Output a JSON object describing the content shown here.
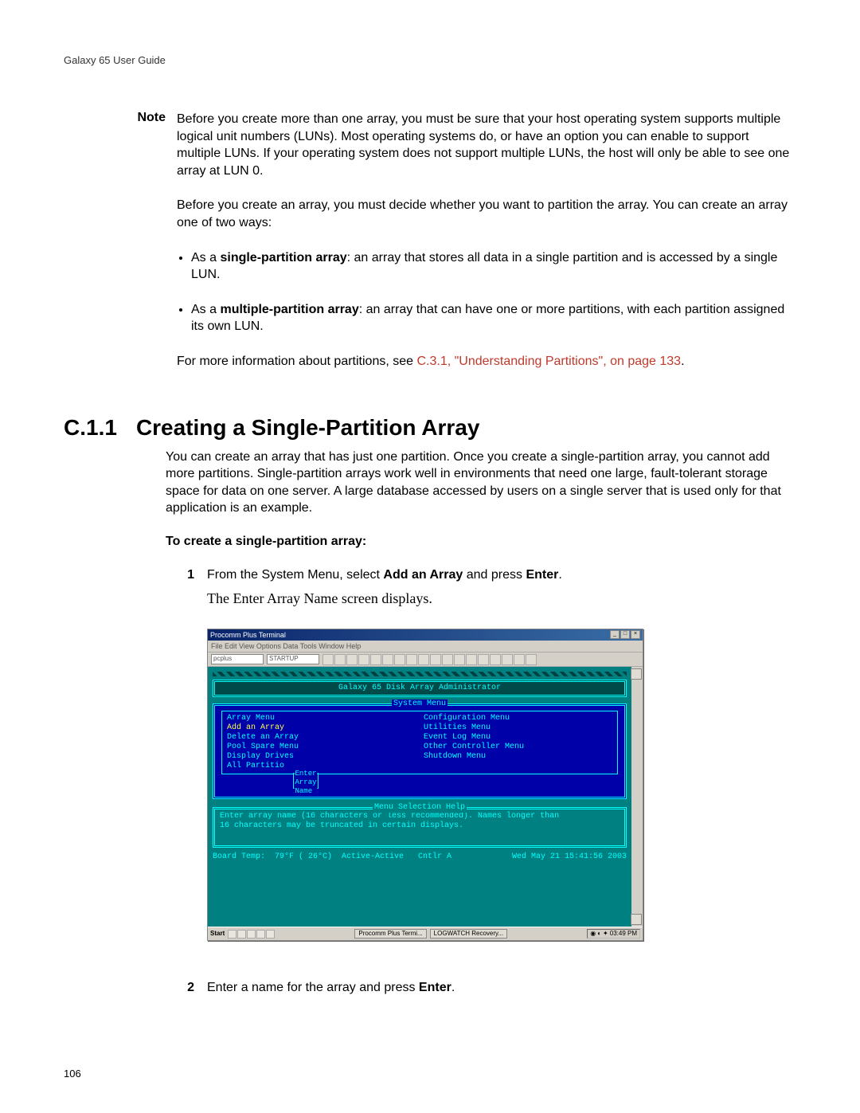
{
  "running_head": "Galaxy 65 User Guide",
  "page_number": "106",
  "note": {
    "label": "Note",
    "p1": "Before you create more than one array, you must be sure that your host operating system supports multiple logical unit numbers (LUNs). Most operating systems do, or have an option you can enable to support multiple LUNs. If your operating system does not support multiple LUNs, the host will only be able to see one array at LUN 0.",
    "p2": "Before you create an array, you must decide whether you want to partition the array. You can create an array one of two ways:",
    "bullet1_pre": "As a ",
    "bullet1_b": "single-partition array",
    "bullet1_post": ": an array that stores all data in a single partition and is accessed by a single LUN.",
    "bullet2_pre": "As a ",
    "bullet2_b": "multiple-partition array",
    "bullet2_post": ": an array that can have one or more partitions, with each partition assigned its own LUN.",
    "p3_pre": "For more information about partitions, see ",
    "p3_link": "C.3.1, \"Understanding Partitions\", on page 133",
    "p3_post": "."
  },
  "section": {
    "num": "C.1.1",
    "title": "Creating a Single-Partition Array",
    "body": "You can create an array that has just one partition. Once you create a single-partition array, you cannot add more partitions. Single-partition arrays work well in environments that need one large, fault-tolerant storage space for data on one server. A large database accessed by users on a single server that is used only for that application is an example.",
    "subhead": "To create a single-partition array:"
  },
  "steps": {
    "s1_num": "1",
    "s1_pre": "From the System Menu, select ",
    "s1_b1": "Add an Array",
    "s1_mid": " and press ",
    "s1_b2": "Enter",
    "s1_post": ".",
    "s1_result": "The Enter Array Name screen displays.",
    "s2_num": "2",
    "s2_pre": "Enter a name for the array and press ",
    "s2_b1": "Enter",
    "s2_post": "."
  },
  "terminal": {
    "title": "Procomm Plus Terminal",
    "menubar": "File  Edit  View  Options  Data  Tools  Window  Help",
    "field1": "pcplus",
    "field2": "STARTUP",
    "admin_title": "Galaxy 65 Disk Array Administrator",
    "sysmenu_label": "System Menu",
    "left": {
      "l1": "Array Menu",
      "l2": "Add an Array",
      "l3": "Delete an Array",
      "l4": "Pool Spare Menu",
      "l5": "Display Drives",
      "l6": "All Partitio"
    },
    "right": {
      "r1": "Configuration Menu",
      "r2": "Utilities Menu",
      "r3": "Event Log Menu",
      "r4": "Other Controller Menu",
      "r5": "Shutdown Menu"
    },
    "inner_label": "Enter Array Name",
    "help_label": "Menu Selection Help",
    "help1": "Enter array name (16 characters or less recommended).  Names longer than",
    "help2": "16 characters may be truncated in certain displays.",
    "status_left": "Board Temp:  79°F ( 26°C)  Active-Active   Cntlr A",
    "status_right": "Wed May 21 15:41:56 2003",
    "task_start": "Start",
    "task_app1": "Procomm Plus Termi...",
    "task_app2": "LOGWATCH Recovery...",
    "task_clock": "03:49 PM"
  }
}
